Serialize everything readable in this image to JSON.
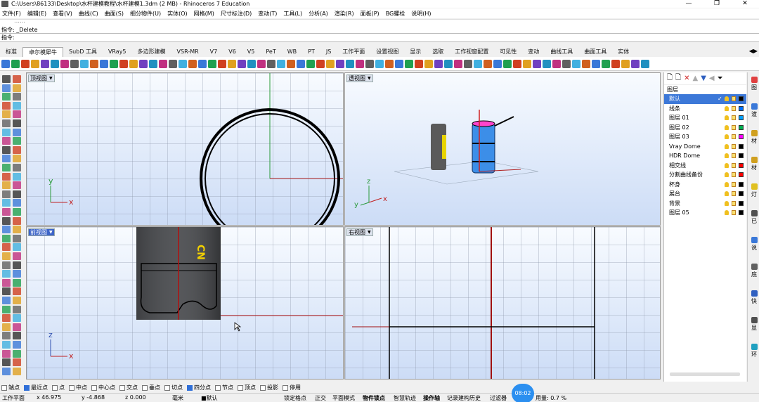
{
  "window": {
    "title": "C:\\Users\\86133\\Desktop\\水杯建模教程\\水杯建模1.3dm (2 MB) - Rhinoceros 7 Education",
    "controls": [
      "—",
      "❐",
      "✕"
    ]
  },
  "menu": [
    "文件(F)",
    "编辑(E)",
    "查看(V)",
    "曲线(C)",
    "曲面(S)",
    "细分物件(U)",
    "实体(O)",
    "网格(M)",
    "尺寸标注(D)",
    "变动(T)",
    "工具(L)",
    "分析(A)",
    "渲染(R)",
    "面板(P)",
    "BG螺栓",
    "说明(H)"
  ],
  "command": {
    "history_cut": "……",
    "history_line": "指令: _Delete",
    "prompt": "指令:"
  },
  "tabs": [
    "标准",
    "卓尔模犀牛",
    "SubD 工具",
    "VRay5",
    "多边形建模",
    "VSR-MR",
    "V7",
    "V6",
    "V5",
    "PeT",
    "WB",
    "PT",
    "JS",
    "工作平面",
    "设置视图",
    "显示",
    "选取",
    "工作视窗配置",
    "可见性",
    "变动",
    "曲线工具",
    "曲面工具",
    "实体"
  ],
  "active_tab": "卓尔模犀牛",
  "tab_overflow": "◀▶",
  "viewports": {
    "top": {
      "title": "顶视图"
    },
    "perspective": {
      "title": "透视图"
    },
    "front": {
      "title": "前视图",
      "image_text": "CN"
    },
    "right": {
      "title": "右视图"
    }
  },
  "axis_labels": {
    "x": "x",
    "y": "y",
    "z": "z"
  },
  "layers": {
    "header": "图层",
    "items": [
      {
        "name": "默认",
        "current": true,
        "check": "✓",
        "color": "#000000"
      },
      {
        "name": "线条",
        "color": "#0070ff"
      },
      {
        "name": "图层 01",
        "color": "#00a0ff"
      },
      {
        "name": "图层 02",
        "color": "#00b050"
      },
      {
        "name": "图层 03",
        "color": "#ff00ff"
      },
      {
        "name": "Vray Dome",
        "color": "#000000"
      },
      {
        "name": "HDR Dome",
        "color": "#000000"
      },
      {
        "name": "相交线",
        "color": "#ff0000"
      },
      {
        "name": "分割曲线备份",
        "color": "#ff0000"
      },
      {
        "name": "杯身",
        "color": "#000000"
      },
      {
        "name": "展台",
        "color": "#000000"
      },
      {
        "name": "背景",
        "color": "#000000"
      },
      {
        "name": "图层 05",
        "color": "#000000"
      }
    ]
  },
  "side_tabs": [
    "图",
    "渲",
    "材",
    "材",
    "灯",
    "已",
    "说",
    "底",
    "快",
    "显",
    "环"
  ],
  "osnap": [
    {
      "label": "端点",
      "on": false
    },
    {
      "label": "最近点",
      "on": true
    },
    {
      "label": "点",
      "on": false
    },
    {
      "label": "中点",
      "on": false
    },
    {
      "label": "中心点",
      "on": false
    },
    {
      "label": "交点",
      "on": false
    },
    {
      "label": "垂点",
      "on": false
    },
    {
      "label": "切点",
      "on": false
    },
    {
      "label": "四分点",
      "on": true
    },
    {
      "label": "节点",
      "on": false
    },
    {
      "label": "顶点",
      "on": false
    },
    {
      "label": "投影",
      "on": false
    },
    {
      "label": "停用",
      "on": false
    }
  ],
  "status": {
    "cplane": "工作平面",
    "x": "x 46.975",
    "y": "y -4.868",
    "z": "z 0.000",
    "unit": "毫米",
    "layer": "■默认",
    "grid_snap": "锁定格点",
    "ortho": "正交",
    "planar": "平面模式",
    "osnap": "物件锁点",
    "smarttrack": "智慧轨迹",
    "gumball": "操作轴",
    "history": "记录建构历史",
    "filter": "过滤器",
    "tolerance": "用量: 0.7 %",
    "time": "08:02"
  }
}
